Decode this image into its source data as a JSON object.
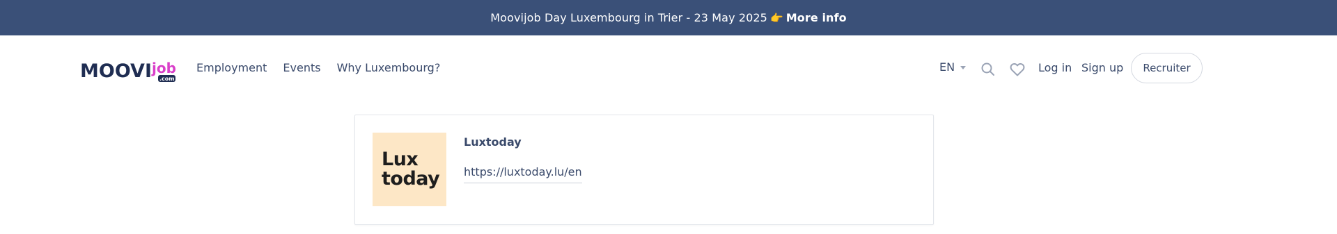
{
  "banner": {
    "text": "Moovijob Day Luxembourg in Trier - 23 May 2025",
    "emoji": "👉",
    "link_label": "More info"
  },
  "header": {
    "logo": {
      "main": "MOOVI",
      "sub": "job",
      "suffix": ".com"
    },
    "nav": [
      {
        "label": "Employment"
      },
      {
        "label": "Events"
      },
      {
        "label": "Why Luxembourg?"
      }
    ],
    "language": "EN",
    "login_label": "Log in",
    "signup_label": "Sign up",
    "recruiter_label": "Recruiter",
    "icons": {
      "search": "search-icon",
      "favorites": "heart-icon"
    }
  },
  "company": {
    "logo_lines": [
      "Lux",
      "today"
    ],
    "name": "Luxtoday",
    "url": "https://luxtoday.lu/en"
  },
  "colors": {
    "banner_bg": "#3a5078",
    "text": "#3a4a6b",
    "logo_bg": "#fde7c6",
    "brand_pink": "#d93fc9",
    "brand_dark": "#1f2d52"
  }
}
